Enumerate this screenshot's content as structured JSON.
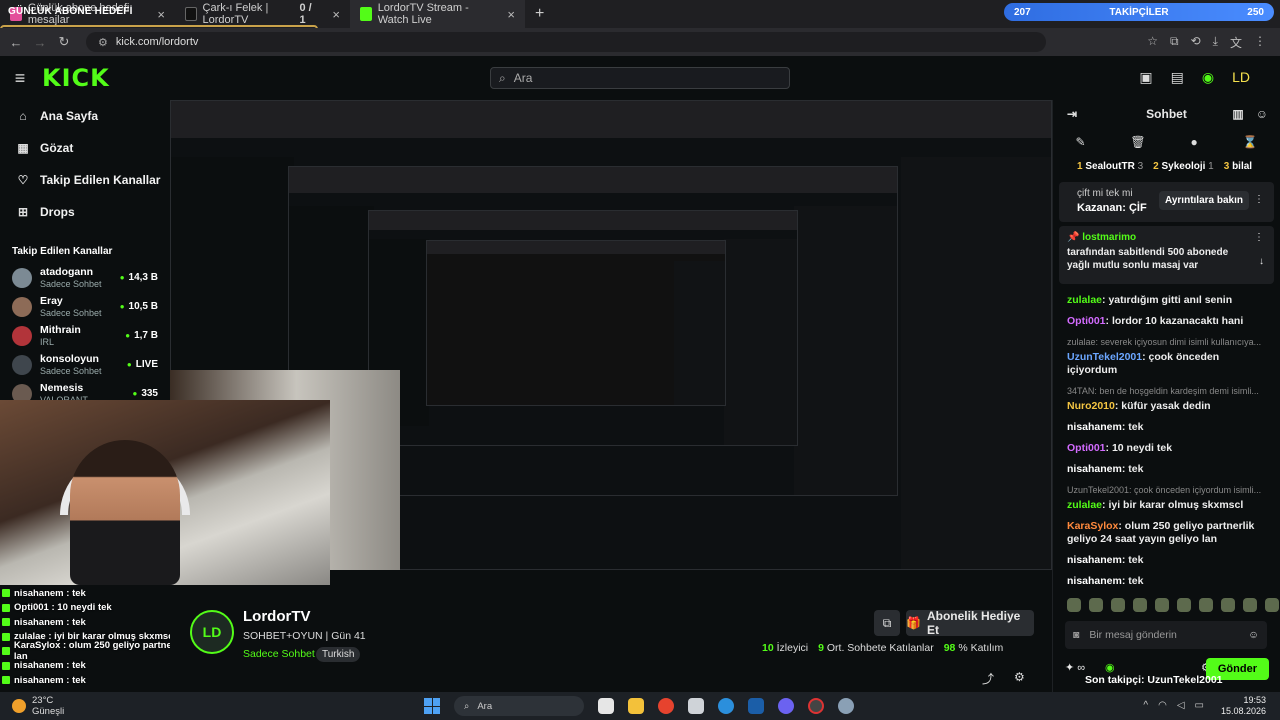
{
  "browser": {
    "tabs": [
      {
        "label": "Günlük abone hedefi mesajlar",
        "active": false
      },
      {
        "label": "Çark-ı Felek | LordorTV",
        "badge": "0 / 1",
        "active": false
      },
      {
        "label": "LordorTV Stream - Watch Live",
        "active": true
      }
    ],
    "url": "kick.com/lordortv"
  },
  "overlay": {
    "goal_label": "GÜNLÜK ABONE HEDEFİ",
    "followers": {
      "current": "207",
      "label": "TAKİPÇİLER",
      "target": "250"
    }
  },
  "header": {
    "logo": "KICK",
    "search_placeholder": "Ara"
  },
  "sidebar": {
    "nav": [
      {
        "icon": "home-icon",
        "label": "Ana Sayfa"
      },
      {
        "icon": "compass-icon",
        "label": "Gözat"
      },
      {
        "icon": "heart-icon",
        "label": "Takip Edilen Kanallar"
      },
      {
        "icon": "drops-icon",
        "label": "Drops"
      }
    ],
    "section_title": "Takip Edilen Kanallar",
    "channels": [
      {
        "name": "atadogann",
        "category": "Sadece Sohbet",
        "viewers": "14,3 B"
      },
      {
        "name": "Eray",
        "category": "Sadece Sohbet",
        "viewers": "10,5 B"
      },
      {
        "name": "Mithrain",
        "category": "IRL",
        "viewers": "1,7 B"
      },
      {
        "name": "konsoloyun",
        "category": "Sadece Sohbet",
        "viewers": "LIVE"
      },
      {
        "name": "Nemesis",
        "category": "VALORANT",
        "viewers": "335"
      }
    ]
  },
  "overlay_chat": [
    "nisahanem : tek",
    "Opti001 : 10 neydi tek",
    "nisahanem : tek",
    "zulalae : iyi bir karar olmuş skxmscl",
    "KaraSylox : olum 250 geliyo partnerlik geliyo 24 saat yayın geliyo lan",
    "nisahanem : tek",
    "nisahanem : tek"
  ],
  "stream": {
    "streamer_name": "LordorTV",
    "avatar_text": "LD",
    "title": "SOHBET+OYUN | Gün 41",
    "category": "Sadece Sohbet",
    "tag": "Turkish",
    "gift_button": "Abonelik Hediye Et",
    "viewers": "10",
    "viewers_label": "İzleyici",
    "chatters": "9",
    "chatters_label": "Ort. Sohbete Katılanlar",
    "participation": "98",
    "participation_label": "% Katılım"
  },
  "chat": {
    "title": "Sohbet",
    "gifters": [
      {
        "rank": "1",
        "name": "SealoutTR",
        "count": "3"
      },
      {
        "rank": "2",
        "name": "Sykeoloji",
        "count": "1"
      },
      {
        "rank": "3",
        "name": "bilal",
        "count": ""
      }
    ],
    "prize": {
      "line1": "çift mi tek mi",
      "line2": "Kazanan:  ÇİF",
      "button": "Ayrıntılara bakın"
    },
    "pinned": {
      "user": "lostmarimo",
      "text": "tarafından sabitlendi 500 abonede yağlı mutlu sonlu masaj var"
    },
    "messages": [
      {
        "reply": "",
        "user": "zulalae",
        "color": "#53fc18",
        "text": "yatırdığım gitti anıl senin"
      },
      {
        "reply": "",
        "user": "Opti001",
        "color": "#d36bff",
        "text": "lordor 10 kazanacaktı hani"
      },
      {
        "reply": "zulalae: severek içiyosun dimi isimli kullanıcıya...",
        "user": "UzunTekel2001",
        "color": "#6ba6ff",
        "text": "çook önceden içiyordum"
      },
      {
        "reply": "34TAN: ben de hoşgeldin kardeşim demi isimli...",
        "user": "Nuro2010",
        "color": "#f4c542",
        "text": "küfür yasak dedin"
      },
      {
        "reply": "",
        "user": "nisahanem",
        "color": "#ffffff",
        "text": "tek"
      },
      {
        "reply": "",
        "user": "Opti001",
        "color": "#d36bff",
        "text": "10 neydi tek"
      },
      {
        "reply": "",
        "user": "nisahanem",
        "color": "#ffffff",
        "text": "tek"
      },
      {
        "reply": "UzunTekel2001: çook önceden içiyordum isimli...",
        "user": "zulalae",
        "color": "#53fc18",
        "text": "iyi bir karar olmuş skxmscl"
      },
      {
        "reply": "",
        "user": "KaraSylox",
        "color": "#ff8a3d",
        "text": "olum 250 geliyo partnerlik geliyo 24 saat yayın geliyo lan"
      },
      {
        "reply": "",
        "user": "nisahanem",
        "color": "#ffffff",
        "text": "tek"
      },
      {
        "reply": "",
        "user": "nisahanem",
        "color": "#ffffff",
        "text": "tek"
      }
    ],
    "input_placeholder": "Bir mesaj gönderin",
    "send_label": "Gönder",
    "last_sub": "Son takipçi: UzunTekel2001"
  },
  "taskbar": {
    "temp": "23°C",
    "weather": "Güneşli",
    "search": "Ara",
    "time": "19:53",
    "date": "15.08.2026"
  }
}
